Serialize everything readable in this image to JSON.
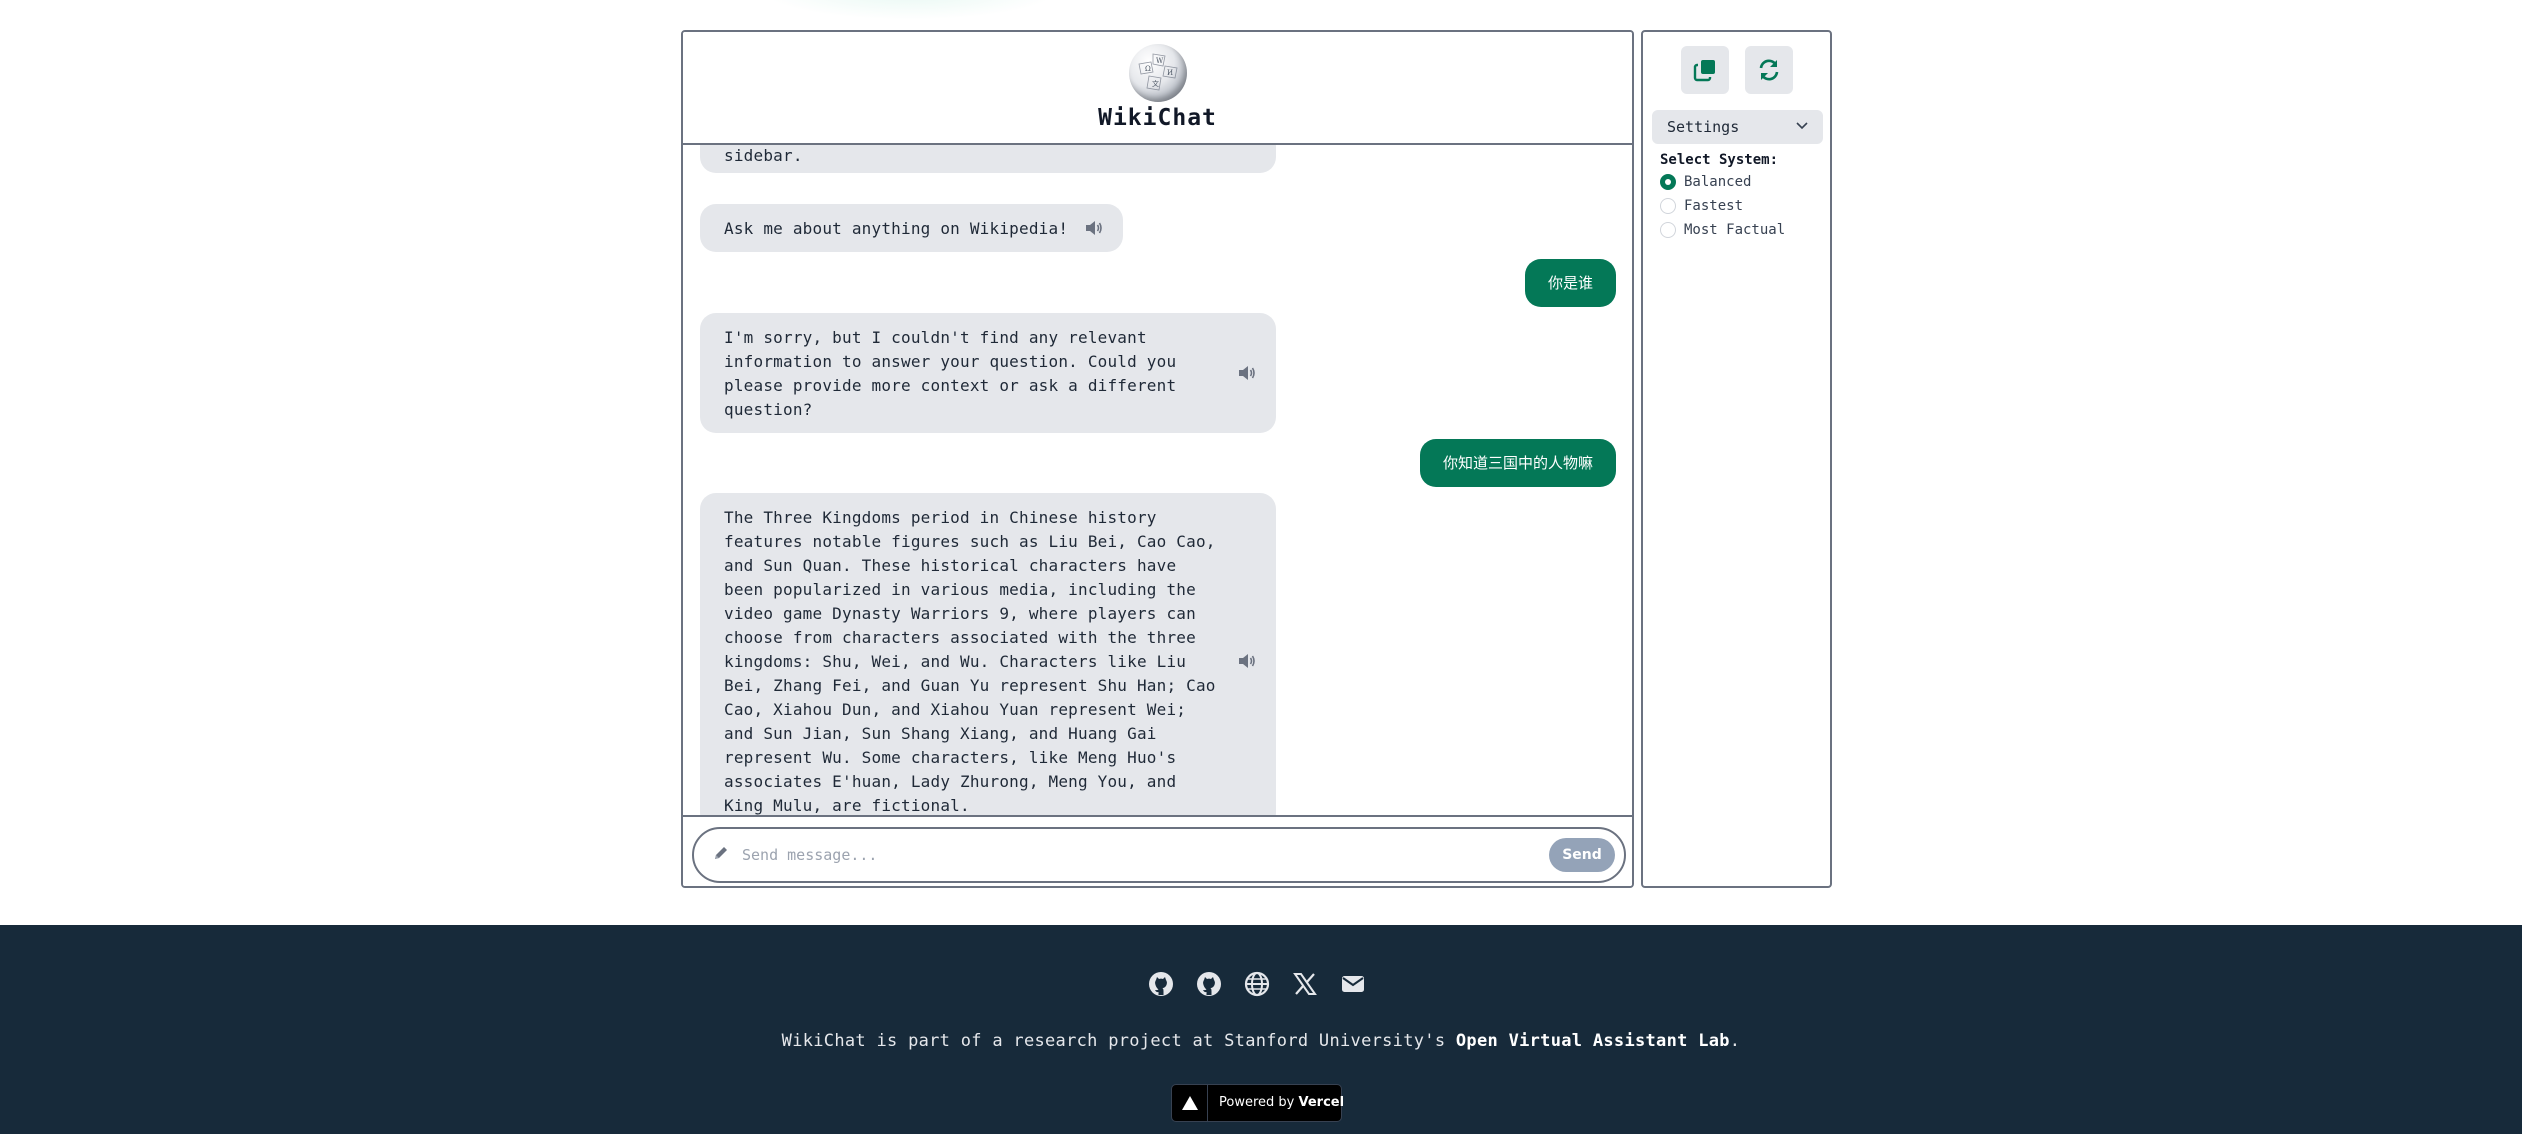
{
  "app": {
    "title": "WikiChat"
  },
  "chat": {
    "messages": [
      {
        "role": "assistant",
        "text": "sidebar."
      },
      {
        "role": "assistant",
        "text": "Ask me about anything on Wikipedia!"
      },
      {
        "role": "user",
        "text": "你是谁"
      },
      {
        "role": "assistant",
        "lines": [
          "I'm sorry, but I couldn't find any relevant",
          "information to answer your question. Could you",
          "please provide more context or ask a different",
          "question?"
        ]
      },
      {
        "role": "user",
        "text": "你知道三国中的人物嘛"
      },
      {
        "role": "assistant",
        "lines": [
          "The Three Kingdoms period in Chinese history",
          "features notable figures such as Liu Bei, Cao Cao,",
          "and Sun Quan. These historical characters have",
          "been popularized in various media, including the",
          "video game Dynasty Warriors 9, where players can",
          "choose from characters associated with the three",
          "kingdoms: Shu, Wei, and Wu. Characters like Liu",
          "Bei, Zhang Fei, and Guan Yu represent Shu Han; Cao",
          "Cao, Xiahou Dun, and Xiahou Yuan represent Wei;",
          "and Sun Jian, Sun Shang Xiang, and Huang Gai",
          "represent Wu. Some characters, like Meng Huo's",
          "associates E'huan, Lady Zhurong, Meng You, and",
          "King Mulu, are fictional."
        ]
      }
    ],
    "input": {
      "placeholder": "Send message...",
      "value": ""
    },
    "send_label": "Send"
  },
  "sidebar": {
    "copy_icon": "copy-icon",
    "refresh_icon": "refresh-icon",
    "settings_label": "Settings",
    "select_label": "Select System:",
    "options": [
      {
        "label": "Balanced",
        "selected": true
      },
      {
        "label": "Fastest",
        "selected": false
      },
      {
        "label": "Most Factual",
        "selected": false
      }
    ]
  },
  "footer": {
    "icons": [
      "github-icon",
      "github-icon",
      "globe-icon",
      "x-twitter-icon",
      "envelope-icon"
    ],
    "text_prefix": "WikiChat is part of a research project at Stanford University's ",
    "text_link": "Open Virtual Assistant Lab",
    "text_suffix": ".",
    "vercel_prefix": "Powered by ",
    "vercel_brand": "Vercel"
  },
  "colors": {
    "accent": "#047857",
    "footer_bg": "#172a3a",
    "bubble_bg": "#e5e7eb",
    "send_disabled": "#94a3b8"
  }
}
